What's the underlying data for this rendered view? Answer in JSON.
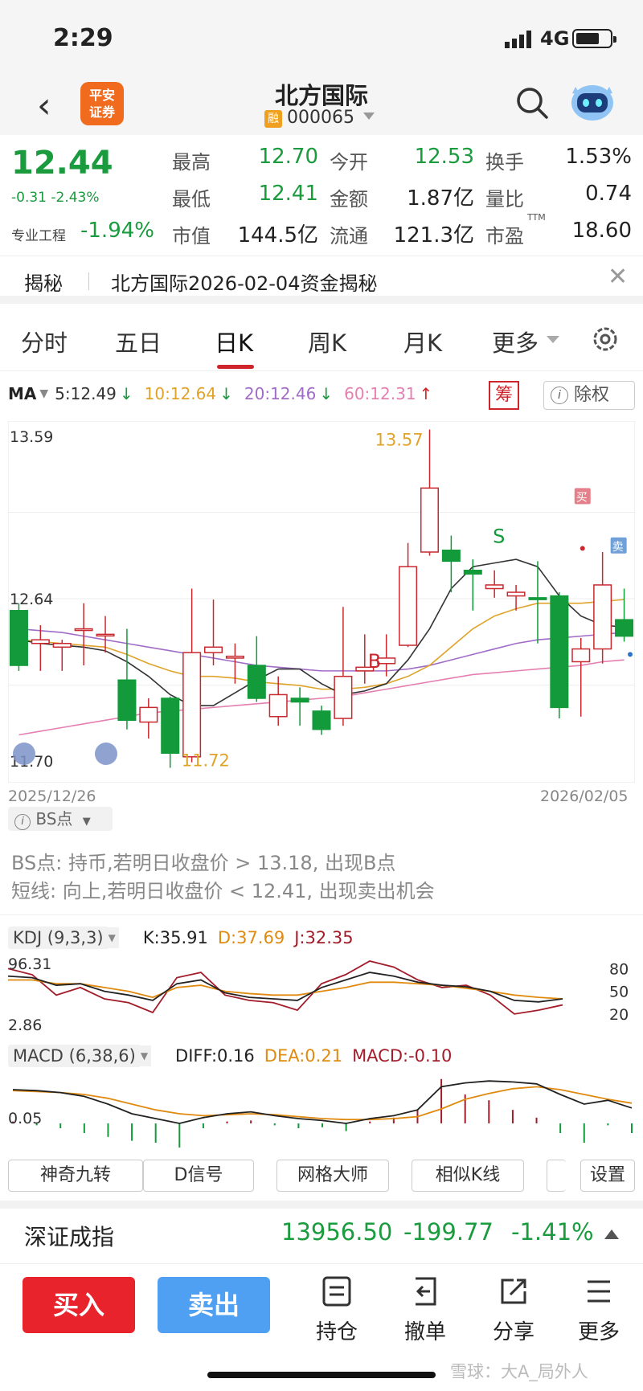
{
  "status": {
    "time": "2:29",
    "network": "4G"
  },
  "header": {
    "logo": "平安\n证券",
    "logo_line1": "平安",
    "logo_line2": "证券",
    "stock_name": "北方国际",
    "margin_tag": "融",
    "code": "000065"
  },
  "quote": {
    "price": "12.44",
    "change": "-0.31 -2.43%",
    "sector_label": "专业工程",
    "sector_change": "-1.94%",
    "fields": [
      {
        "label": "最高",
        "value": "12.70",
        "color": "#1a9b3e"
      },
      {
        "label": "今开",
        "value": "12.53",
        "color": "#1a9b3e"
      },
      {
        "label": "换手",
        "value": "1.53%",
        "color": "#222222"
      },
      {
        "label": "最低",
        "value": "12.41",
        "color": "#1a9b3e"
      },
      {
        "label": "金额",
        "value": "1.87亿",
        "color": "#222222"
      },
      {
        "label": "量比",
        "value": "0.74",
        "color": "#222222"
      },
      {
        "label": "市值",
        "value": "144.5亿",
        "color": "#222222"
      },
      {
        "label": "流通",
        "value": "121.3亿",
        "color": "#222222"
      },
      {
        "label": "市盈",
        "value": "18.60",
        "color": "#222222"
      }
    ],
    "pe_suffix": "TTM"
  },
  "banner": {
    "tag": "揭秘",
    "text": "北方国际2026-02-04资金揭秘"
  },
  "tabs": [
    "分时",
    "五日",
    "日K",
    "周K",
    "月K",
    "更多"
  ],
  "active_tab": "日K",
  "ma": {
    "label": "MA",
    "items": [
      {
        "text": "5:12.49",
        "color": "#333333",
        "arrow": "↓",
        "arrow_color": "#1a9b3e"
      },
      {
        "text": "10:12.64",
        "color": "#e0a32a",
        "arrow": "↓",
        "arrow_color": "#1a9b3e"
      },
      {
        "text": "20:12.46",
        "color": "#a06cc8",
        "arrow": "↓",
        "arrow_color": "#1a9b3e"
      },
      {
        "text": "60:12.31",
        "color": "#e57fb0",
        "arrow": "↑",
        "arrow_color": "#d0242b"
      }
    ],
    "chou": "筹",
    "chuquan": "除权"
  },
  "chart_data": {
    "type": "candlestick",
    "y_high_label": "13.59",
    "y_mid_label": "12.64",
    "y_low_label": "11.70",
    "ylim": [
      11.7,
      13.59
    ],
    "max_label": "13.57",
    "min_label": "11.72",
    "date_start": "2025/12/26",
    "date_end": "2026/02/05",
    "marker_buy": "B",
    "marker_sell": "S",
    "tag_buy": "买",
    "tag_sell": "卖",
    "candles": [
      [
        12.58,
        12.28,
        12.62,
        12.25
      ],
      [
        12.4,
        12.42,
        12.5,
        12.25
      ],
      [
        12.38,
        12.4,
        12.42,
        12.25
      ],
      [
        12.48,
        12.48,
        12.62,
        12.28
      ],
      [
        12.45,
        12.45,
        12.55,
        12.35
      ],
      [
        12.2,
        11.98,
        12.48,
        11.93
      ],
      [
        11.97,
        12.05,
        12.1,
        11.88
      ],
      [
        12.1,
        11.8,
        12.11,
        11.72
      ],
      [
        11.78,
        12.35,
        12.7,
        11.75
      ],
      [
        12.35,
        12.38,
        12.64,
        12.28
      ],
      [
        12.32,
        12.33,
        12.4,
        12.18
      ],
      [
        12.28,
        12.1,
        12.44,
        12.08
      ],
      [
        12.0,
        12.12,
        12.22,
        11.95
      ],
      [
        12.1,
        12.08,
        12.16,
        11.95
      ],
      [
        12.03,
        11.93,
        12.06,
        11.9
      ],
      [
        11.99,
        12.22,
        12.6,
        11.95
      ],
      [
        12.25,
        12.27,
        12.45,
        12.18
      ],
      [
        12.29,
        12.32,
        12.45,
        12.22
      ],
      [
        12.39,
        12.82,
        12.95,
        12.38
      ],
      [
        12.9,
        13.25,
        13.57,
        12.88
      ],
      [
        12.91,
        12.85,
        12.99,
        12.68
      ],
      [
        12.8,
        12.78,
        12.86,
        12.58
      ],
      [
        12.7,
        12.72,
        12.8,
        12.65
      ],
      [
        12.66,
        12.68,
        12.72,
        12.58
      ],
      [
        12.65,
        12.64,
        12.85,
        12.4
      ],
      [
        12.66,
        12.05,
        12.68,
        11.99
      ],
      [
        12.3,
        12.37,
        12.43,
        12.0
      ],
      [
        12.37,
        12.72,
        12.9,
        12.29
      ],
      [
        12.53,
        12.44,
        12.7,
        12.41
      ]
    ],
    "ma5": [
      12.42,
      12.4,
      12.39,
      12.38,
      12.36,
      12.3,
      12.22,
      12.12,
      12.06,
      12.06,
      12.13,
      12.2,
      12.26,
      12.26,
      12.18,
      12.12,
      12.14,
      12.18,
      12.31,
      12.48,
      12.7,
      12.82,
      12.84,
      12.86,
      12.82,
      12.66,
      12.55,
      12.5,
      12.49
    ],
    "ma10": [
      12.42,
      12.41,
      12.4,
      12.39,
      12.38,
      12.34,
      12.29,
      12.25,
      12.22,
      12.22,
      12.21,
      12.19,
      12.18,
      12.17,
      12.15,
      12.15,
      12.16,
      12.18,
      12.22,
      12.28,
      12.38,
      12.48,
      12.55,
      12.59,
      12.62,
      12.62,
      12.62,
      12.63,
      12.64
    ],
    "ma20": [
      12.48,
      12.47,
      12.46,
      12.44,
      12.42,
      12.4,
      12.38,
      12.36,
      12.34,
      12.32,
      12.3,
      12.28,
      12.27,
      12.26,
      12.25,
      12.25,
      12.25,
      12.25,
      12.26,
      12.28,
      12.31,
      12.34,
      12.37,
      12.4,
      12.42,
      12.43,
      12.44,
      12.45,
      12.46
    ],
    "ma60": [
      11.9,
      11.92,
      11.94,
      11.96,
      11.98,
      12.0,
      12.02,
      12.03,
      12.04,
      12.05,
      12.06,
      12.07,
      12.08,
      12.09,
      12.1,
      12.11,
      12.13,
      12.15,
      12.17,
      12.19,
      12.21,
      12.23,
      12.24,
      12.25,
      12.26,
      12.27,
      12.28,
      12.3,
      12.31
    ]
  },
  "bs": {
    "chip": "BS点",
    "line1": "BS点: 持币,若明日收盘价 > 13.18, 出现B点",
    "line2": "短线: 向上,若明日收盘价 < 12.41, 出现卖出机会"
  },
  "kdj": {
    "label": "KDJ (9,3,3)",
    "k": "K:35.91",
    "d": "D:37.69",
    "j": "J:32.35",
    "y_top": "96.31",
    "y_bottom": "2.86",
    "right_ticks": [
      "80",
      "50",
      "20"
    ],
    "ylim": [
      2.86,
      96.31
    ],
    "K": [
      70,
      68,
      58,
      60,
      50,
      45,
      38,
      60,
      65,
      48,
      42,
      40,
      38,
      55,
      65,
      75,
      70,
      62,
      58,
      56,
      50,
      38,
      36,
      40
    ],
    "D": [
      65,
      65,
      60,
      60,
      55,
      50,
      42,
      55,
      58,
      50,
      47,
      45,
      45,
      50,
      55,
      62,
      62,
      60,
      58,
      54,
      50,
      45,
      42,
      40
    ],
    "J": [
      80,
      72,
      45,
      55,
      40,
      35,
      22,
      68,
      75,
      45,
      38,
      35,
      25,
      60,
      72,
      90,
      82,
      65,
      55,
      58,
      45,
      20,
      25,
      32
    ]
  },
  "macd": {
    "label": "MACD (6,38,6)",
    "diff": "DIFF:0.16",
    "dea": "DEA:0.21",
    "macd": "MACD:-0.10",
    "y_label": "0.05",
    "ylim": [
      -0.3,
      0.55
    ],
    "DIFF": [
      0.35,
      0.34,
      0.32,
      0.28,
      0.2,
      0.1,
      0.05,
      0.0,
      0.06,
      0.1,
      0.12,
      0.08,
      0.05,
      0.03,
      0.0,
      0.05,
      0.08,
      0.14,
      0.38,
      0.42,
      0.44,
      0.43,
      0.41,
      0.3,
      0.2,
      0.24,
      0.16
    ],
    "DEA": [
      0.34,
      0.33,
      0.32,
      0.3,
      0.26,
      0.2,
      0.14,
      0.1,
      0.08,
      0.09,
      0.1,
      0.09,
      0.07,
      0.05,
      0.04,
      0.04,
      0.05,
      0.07,
      0.15,
      0.25,
      0.31,
      0.36,
      0.38,
      0.35,
      0.3,
      0.25,
      0.21
    ],
    "HIST": [
      0.02,
      -0.02,
      -0.05,
      -0.1,
      -0.14,
      -0.18,
      -0.2,
      -0.25,
      -0.05,
      0.02,
      0.03,
      -0.02,
      -0.05,
      -0.04,
      -0.08,
      0.02,
      0.06,
      0.14,
      0.46,
      0.3,
      0.24,
      0.14,
      0.06,
      -0.1,
      -0.2,
      -0.02,
      -0.1
    ]
  },
  "tools": [
    "神奇九转",
    "D信号",
    "网格大师",
    "相似K线",
    "",
    "设置"
  ],
  "index": {
    "name": "深证成指",
    "value": "13956.50",
    "change": "-199.77",
    "pct": "-1.41%"
  },
  "bottom": {
    "buy": "买入",
    "sell": "卖出",
    "items": [
      {
        "label": "持仓",
        "icon": "document-icon"
      },
      {
        "label": "撤单",
        "icon": "undo-icon"
      },
      {
        "label": "分享",
        "icon": "share-icon"
      },
      {
        "label": "更多",
        "icon": "list-icon"
      }
    ],
    "watermark": "雪球：大A_局外人"
  }
}
